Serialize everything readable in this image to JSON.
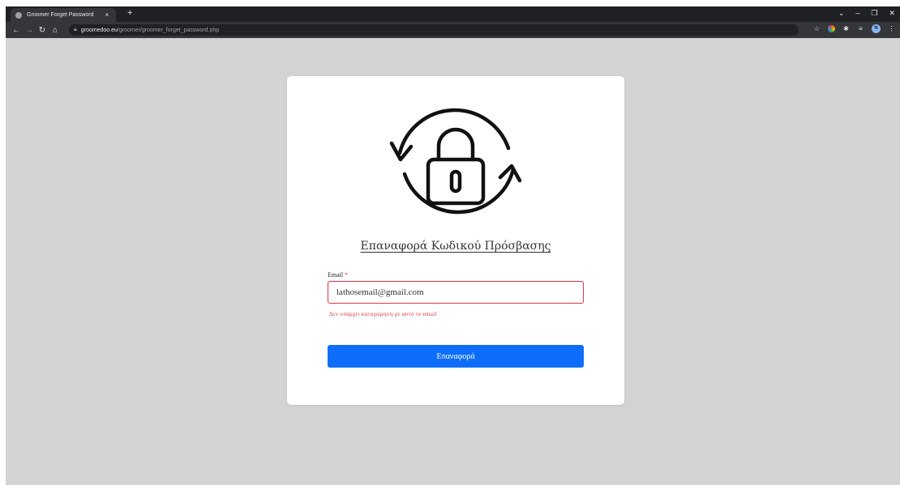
{
  "browser": {
    "tab_title": "Groomer Forget Password",
    "tab_close": "×",
    "new_tab": "+",
    "url_host": "groomedoo.eu",
    "url_path": "/groomer/groomer_forget_password.php",
    "avatar_initial": "N"
  },
  "page": {
    "title": "Επαναφορά Κωδικού Πρόσβασης",
    "email_label": "Email",
    "required_mark": "*",
    "email_value": "lathosemail@gmail.com",
    "error_message": "Δεν υπάρχει καταχώρηση με αυτό το email",
    "submit_label": "Επαναφορά"
  },
  "colors": {
    "page_bg": "#d3d3d3",
    "error": "#dc3545",
    "primary": "#0d6efd"
  }
}
